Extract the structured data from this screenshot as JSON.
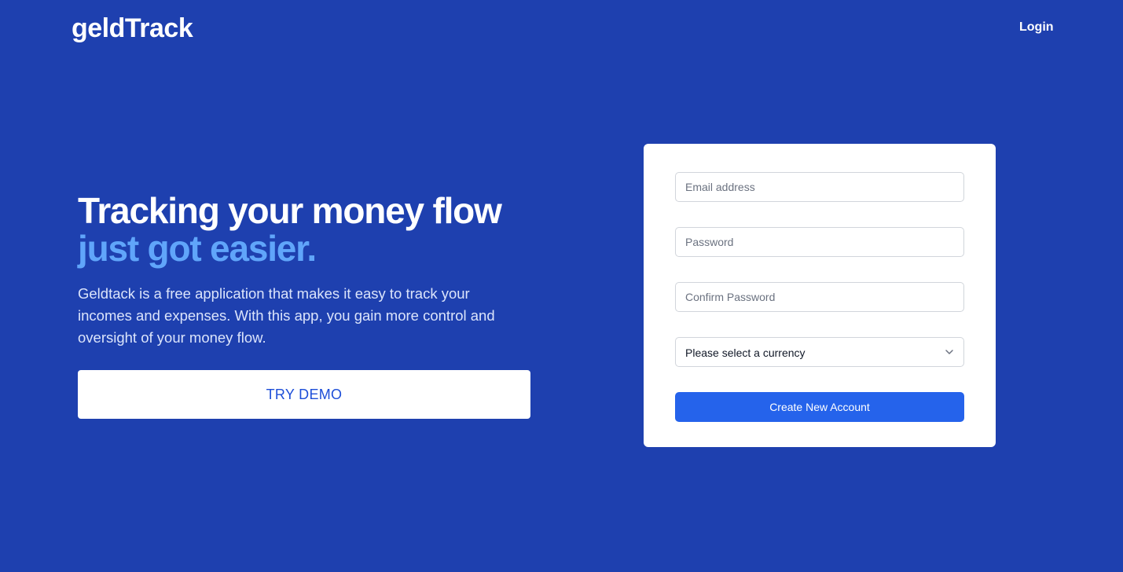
{
  "header": {
    "logo": "geldTrack",
    "login_label": "Login"
  },
  "hero": {
    "headline_line1": "Tracking your money flow",
    "headline_line2": "just got easier.",
    "description": "Geldtack is a free application that makes it easy to track your incomes and expenses. With this app, you gain more control and oversight of your money flow.",
    "demo_button_label": "TRY DEMO"
  },
  "signup": {
    "email_placeholder": "Email address",
    "password_placeholder": "Password",
    "confirm_password_placeholder": "Confirm Password",
    "currency_select_value": "Please select a currency",
    "submit_label": "Create New Account"
  },
  "colors": {
    "background": "#1e40af",
    "accent_text": "#60a5fa",
    "primary_button": "#2563eb"
  },
  "icons": {
    "select_arrow": "chevron-down-icon"
  }
}
